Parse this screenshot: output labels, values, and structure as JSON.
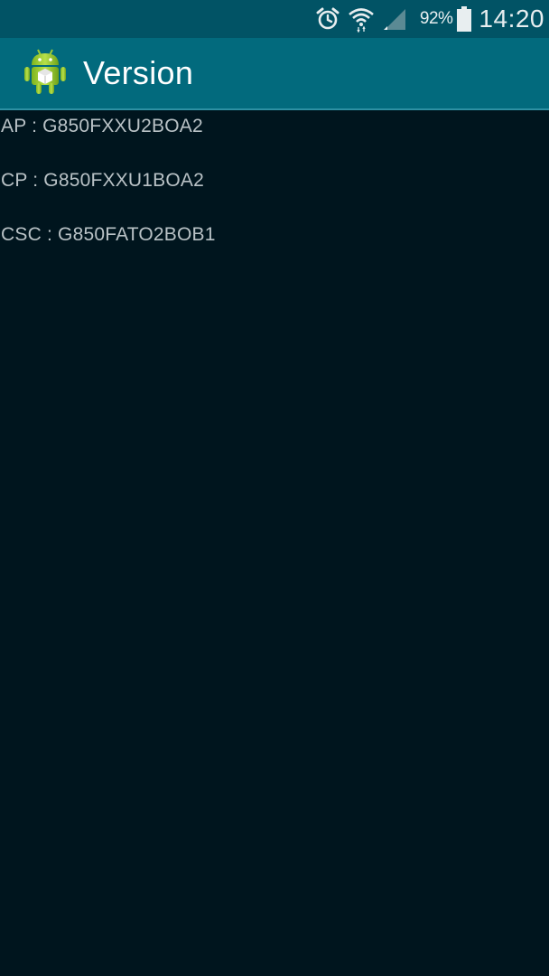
{
  "status_bar": {
    "battery_percent": "92%",
    "time": "14:20",
    "icons": [
      "alarm-icon",
      "wifi-icon",
      "signal-icon",
      "battery-icon"
    ]
  },
  "app_bar": {
    "title": "Version",
    "icon": "android-robot-icon"
  },
  "versions": [
    {
      "label": "AP : G850FXXU2BOA2"
    },
    {
      "label": "CP : G850FXXU1BOA2"
    },
    {
      "label": "CSC : G850FATO2BOB1"
    }
  ],
  "colors": {
    "status_bar": "#015365",
    "action_bar": "#026a7d",
    "background": "#00151e",
    "text": "#b9c2c6"
  }
}
